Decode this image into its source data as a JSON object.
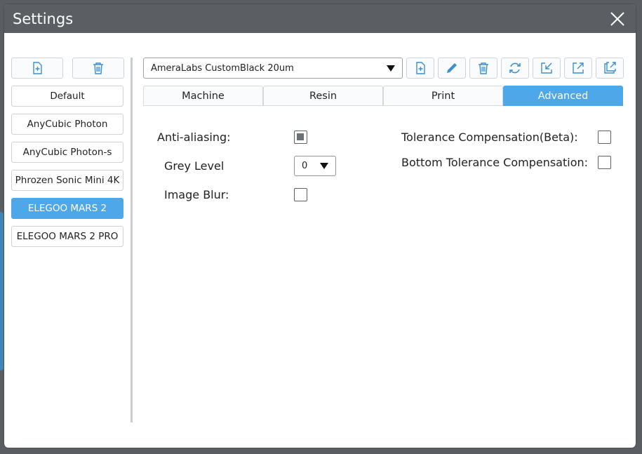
{
  "window": {
    "title": "Settings"
  },
  "left_panel": {
    "profiles": [
      {
        "label": "Default",
        "active": false
      },
      {
        "label": "AnyCubic Photon",
        "active": false
      },
      {
        "label": "AnyCubic Photon-s",
        "active": false
      },
      {
        "label": "Phrozen Sonic Mini 4K",
        "active": false
      },
      {
        "label": "ELEGOO MARS 2",
        "active": true
      },
      {
        "label": "ELEGOO MARS 2 PRO",
        "active": false
      }
    ]
  },
  "right_panel": {
    "resin_profile": "AmeraLabs CustomBlack 20um",
    "tabs": [
      {
        "label": "Machine",
        "active": false
      },
      {
        "label": "Resin",
        "active": false
      },
      {
        "label": "Print",
        "active": false
      },
      {
        "label": "Advanced",
        "active": true
      }
    ],
    "advanced": {
      "anti_aliasing_label": "Anti-aliasing:",
      "anti_aliasing_checked": true,
      "grey_level_label": "Grey Level",
      "grey_level_value": "0",
      "image_blur_label": "Image Blur:",
      "image_blur_checked": false,
      "tolerance_label": "Tolerance Compensation(Beta):",
      "tolerance_checked": false,
      "bottom_tolerance_label": "Bottom Tolerance Compensation:",
      "bottom_tolerance_checked": false
    }
  },
  "colors": {
    "accent": "#4ea7e8",
    "titlebar": "#5b5f64"
  }
}
